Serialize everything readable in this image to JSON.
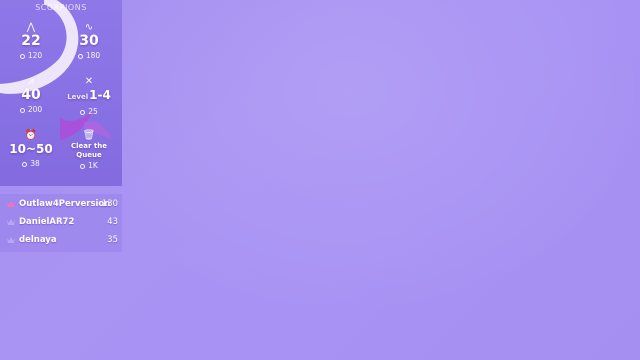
{
  "tip_menu": {
    "title": "SCORPIONS",
    "items": [
      {
        "icon": "vibe-low-icon",
        "level_text": "",
        "value": "22",
        "price": "120"
      },
      {
        "icon": "vibe-wave-icon",
        "level_text": "",
        "value": "30",
        "price": "180"
      },
      {
        "icon": "vibe-high-icon",
        "level_text": "",
        "value": "40",
        "price": "200"
      },
      {
        "icon": "vibe-random-icon",
        "level_text": "Level",
        "value": "1-4",
        "price": "25"
      },
      {
        "icon": "clock-icon",
        "level_text": "",
        "value": "10~50",
        "price": "38"
      },
      {
        "icon": "trash-icon",
        "level_text": "",
        "value": "Clear the Queue",
        "price": "1K"
      }
    ]
  },
  "leaderboard": {
    "rows": [
      {
        "name": "Outlaw4Perversion",
        "score": "130"
      },
      {
        "name": "DanielAR72",
        "score": "43"
      },
      {
        "name": "delnaya",
        "score": "35"
      }
    ]
  },
  "colors": {
    "background": "#a891f3",
    "panel": "#8c76e8",
    "swoosh": "#f3eefc",
    "text": "#ffffff"
  }
}
